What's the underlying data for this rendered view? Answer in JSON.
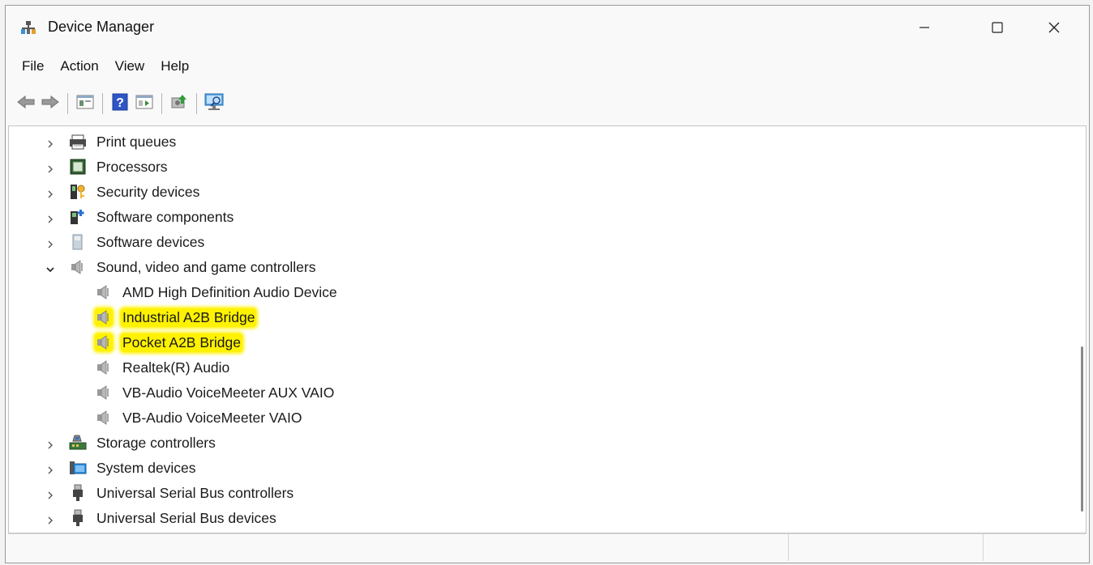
{
  "window": {
    "title": "Device Manager",
    "app_icon": "device-manager-icon",
    "controls": {
      "minimize": "minimize-icon",
      "maximize": "maximize-icon",
      "close": "close-icon"
    }
  },
  "menu": {
    "items": [
      {
        "label": "File"
      },
      {
        "label": "Action"
      },
      {
        "label": "View"
      },
      {
        "label": "Help"
      }
    ]
  },
  "toolbar": {
    "buttons": [
      "back-arrow-icon",
      "forward-arrow-icon",
      "properties-icon",
      "help-icon",
      "show-hide-console-tree-icon",
      "update-driver-icon",
      "scan-hardware-icon"
    ]
  },
  "tree": {
    "items": [
      {
        "label": "Print queues",
        "icon": "printer-icon",
        "level": 0,
        "expanded": false,
        "highlighted": false
      },
      {
        "label": "Processors",
        "icon": "processor-icon",
        "level": 0,
        "expanded": false,
        "highlighted": false
      },
      {
        "label": "Security devices",
        "icon": "security-device-icon",
        "level": 0,
        "expanded": false,
        "highlighted": false
      },
      {
        "label": "Software components",
        "icon": "software-component-icon",
        "level": 0,
        "expanded": false,
        "highlighted": false
      },
      {
        "label": "Software devices",
        "icon": "software-device-icon",
        "level": 0,
        "expanded": false,
        "highlighted": false
      },
      {
        "label": "Sound, video and game controllers",
        "icon": "speaker-icon",
        "level": 0,
        "expanded": true,
        "highlighted": false
      },
      {
        "label": "AMD High Definition Audio Device",
        "icon": "speaker-icon",
        "level": 1,
        "highlighted": false
      },
      {
        "label": "Industrial A2B Bridge",
        "icon": "speaker-icon",
        "level": 1,
        "highlighted": true
      },
      {
        "label": "Pocket A2B Bridge",
        "icon": "speaker-icon",
        "level": 1,
        "highlighted": true
      },
      {
        "label": "Realtek(R) Audio",
        "icon": "speaker-icon",
        "level": 1,
        "highlighted": false
      },
      {
        "label": "VB-Audio VoiceMeeter AUX VAIO",
        "icon": "speaker-icon",
        "level": 1,
        "highlighted": false
      },
      {
        "label": "VB-Audio VoiceMeeter VAIO",
        "icon": "speaker-icon",
        "level": 1,
        "highlighted": false
      },
      {
        "label": "Storage controllers",
        "icon": "storage-controller-icon",
        "level": 0,
        "expanded": false,
        "highlighted": false
      },
      {
        "label": "System devices",
        "icon": "system-device-icon",
        "level": 0,
        "expanded": false,
        "highlighted": false
      },
      {
        "label": "Universal Serial Bus controllers",
        "icon": "usb-icon",
        "level": 0,
        "expanded": false,
        "highlighted": false
      },
      {
        "label": "Universal Serial Bus devices",
        "icon": "usb-icon",
        "level": 0,
        "expanded": false,
        "highlighted": false
      }
    ]
  },
  "colors": {
    "highlight": "#fff200",
    "window_bg": "#f9f9f9",
    "tree_bg": "#ffffff"
  }
}
